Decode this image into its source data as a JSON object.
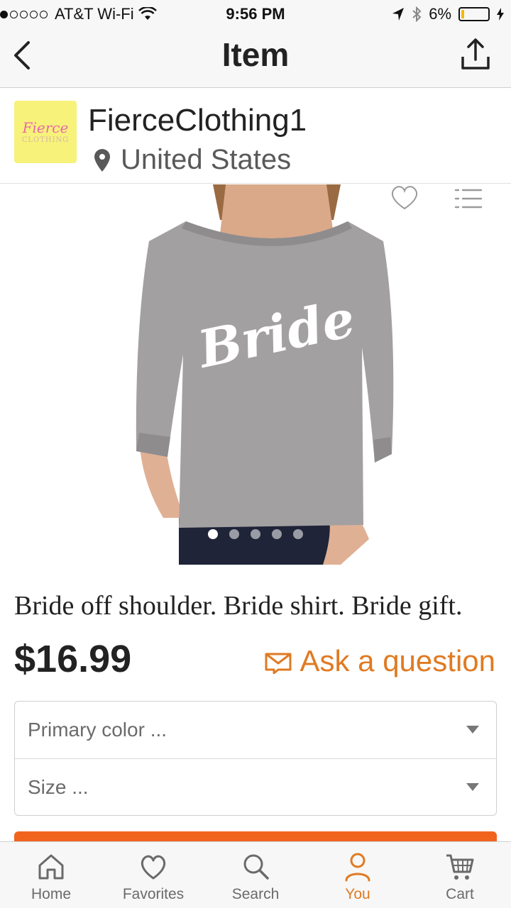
{
  "status_bar": {
    "carrier": "AT&T Wi-Fi",
    "time": "9:56 PM",
    "battery": "6%"
  },
  "nav": {
    "title": "Item"
  },
  "shop": {
    "logo_text": "Fierce",
    "logo_subtext": "CLOTHING",
    "name": "FierceClothing1",
    "location": "United States"
  },
  "product": {
    "shirt_print": "Bride",
    "image_count": 5,
    "active_image": 1,
    "title": "Bride off shoulder. Bride shirt. Bride gift.",
    "price": "$16.99",
    "ask_label": "Ask a question"
  },
  "options": [
    {
      "label": "Primary color ..."
    },
    {
      "label": "Size ..."
    }
  ],
  "tabs": [
    {
      "label": "Home",
      "icon": "home-icon"
    },
    {
      "label": "Favorites",
      "icon": "heart-icon"
    },
    {
      "label": "Search",
      "icon": "search-icon"
    },
    {
      "label": "You",
      "icon": "person-icon"
    },
    {
      "label": "Cart",
      "icon": "cart-icon"
    }
  ],
  "colors": {
    "accent": "#e07a22",
    "cta": "#f1641e"
  }
}
